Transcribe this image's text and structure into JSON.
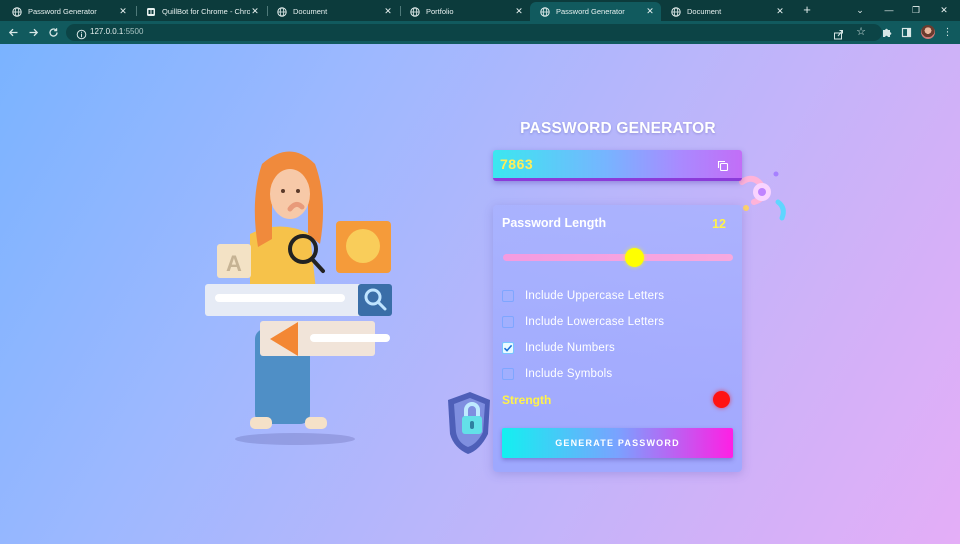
{
  "browser": {
    "tabs": [
      {
        "title": "Password Generator",
        "active": false
      },
      {
        "title": "QuillBot for Chrome - Chro",
        "active": false
      },
      {
        "title": "Document",
        "active": false
      },
      {
        "title": "Portfolio",
        "active": false
      },
      {
        "title": "Password Generator",
        "active": true
      },
      {
        "title": "Document",
        "active": false
      }
    ],
    "url_host": "127.0.0.1",
    "url_port": ":5500"
  },
  "app": {
    "title": "PASSWORD GENERATOR",
    "password": "7863",
    "length_label": "Password Length",
    "length_value": "12",
    "slider_fraction": 0.57,
    "options": [
      {
        "label": "Include Uppercase Letters",
        "checked": false
      },
      {
        "label": "Include Lowercase Letters",
        "checked": false
      },
      {
        "label": "Include Numbers",
        "checked": true
      },
      {
        "label": "Include Symbols",
        "checked": false
      }
    ],
    "strength_label": "Strength",
    "strength_color": "#ff1313",
    "generate_label": "GENERATE PASSWORD"
  }
}
